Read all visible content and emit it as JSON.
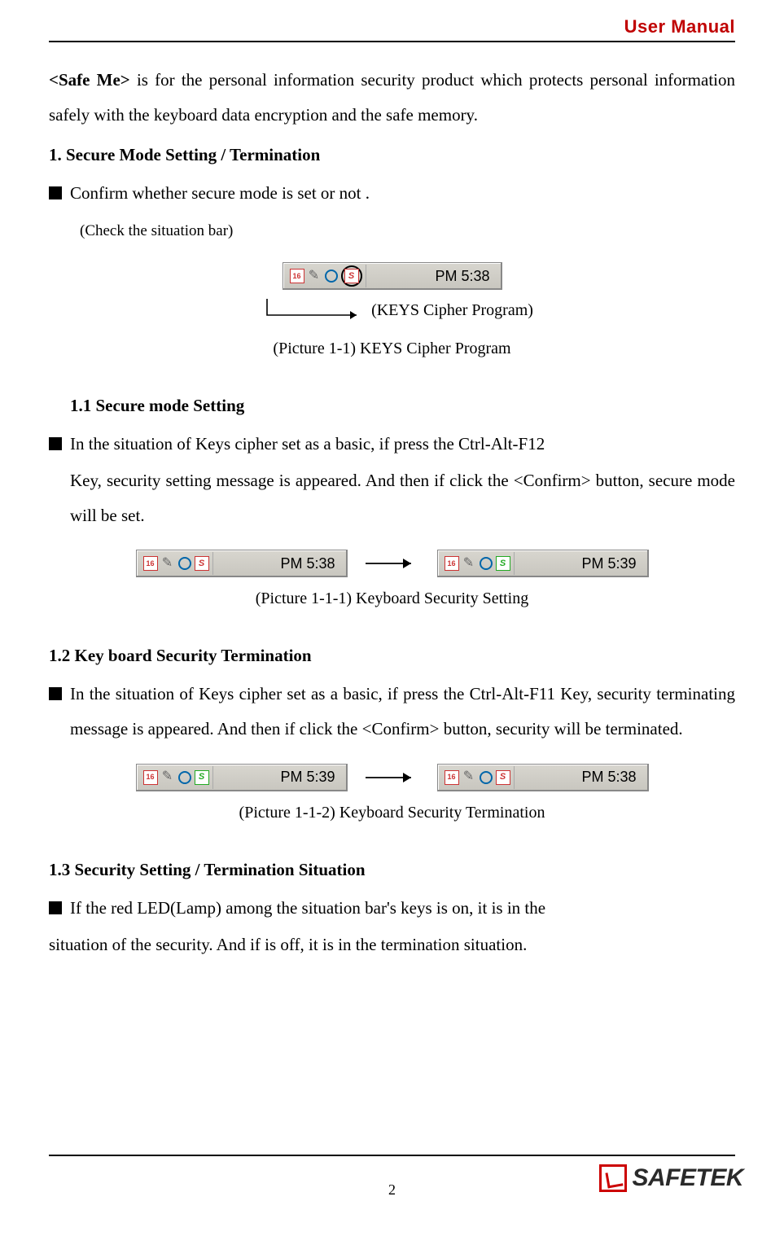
{
  "header": {
    "title": "User Manual"
  },
  "intro": {
    "bold_prefix": "<Safe Me>",
    "text_rest": " is for the personal information security product which protects personal information safely with the keyboard data encryption and the safe memory."
  },
  "sec1": {
    "heading": "1. Secure Mode Setting / Termination",
    "bullet": "Confirm whether secure mode is set or not .",
    "check_note": "(Check the situation bar)",
    "callout": "(KEYS Cipher Program)",
    "fig_label": "(Picture 1-1) KEYS Cipher Program",
    "taskbar_time": "PM 5:38"
  },
  "sec11": {
    "heading": "1.1 Secure mode Setting",
    "bullet_line1": "In the situation of Keys cipher set as a basic, if press the Ctrl-Alt-F12",
    "para_rest": "Key, security setting message is appeared. And then if click the <Confirm> button, secure mode will be set.",
    "fig_label": "(Picture 1-1-1) Keyboard Security Setting",
    "time_left": "PM 5:38",
    "time_right": "PM 5:39"
  },
  "sec12": {
    "heading": "1.2 Key board Security Termination",
    "bullet": "In the situation of Keys cipher set as a basic, if press the Ctrl-Alt-F11 Key, security terminating message is appeared. And then if click the <Confirm> button, security will be terminated.",
    "fig_label": "(Picture 1-1-2) Keyboard Security Termination",
    "time_left": "PM 5:39",
    "time_right": "PM 5:38"
  },
  "sec13": {
    "heading": "1.3 Security Setting / Termination Situation",
    "bullet_line1": "If the red LED(Lamp) among the situation bar's keys is on, it is in the",
    "para_rest": "situation of the security. And if is off, it is in the termination situation."
  },
  "footer": {
    "page_number": "2",
    "logo_text": "SAFETEK"
  }
}
